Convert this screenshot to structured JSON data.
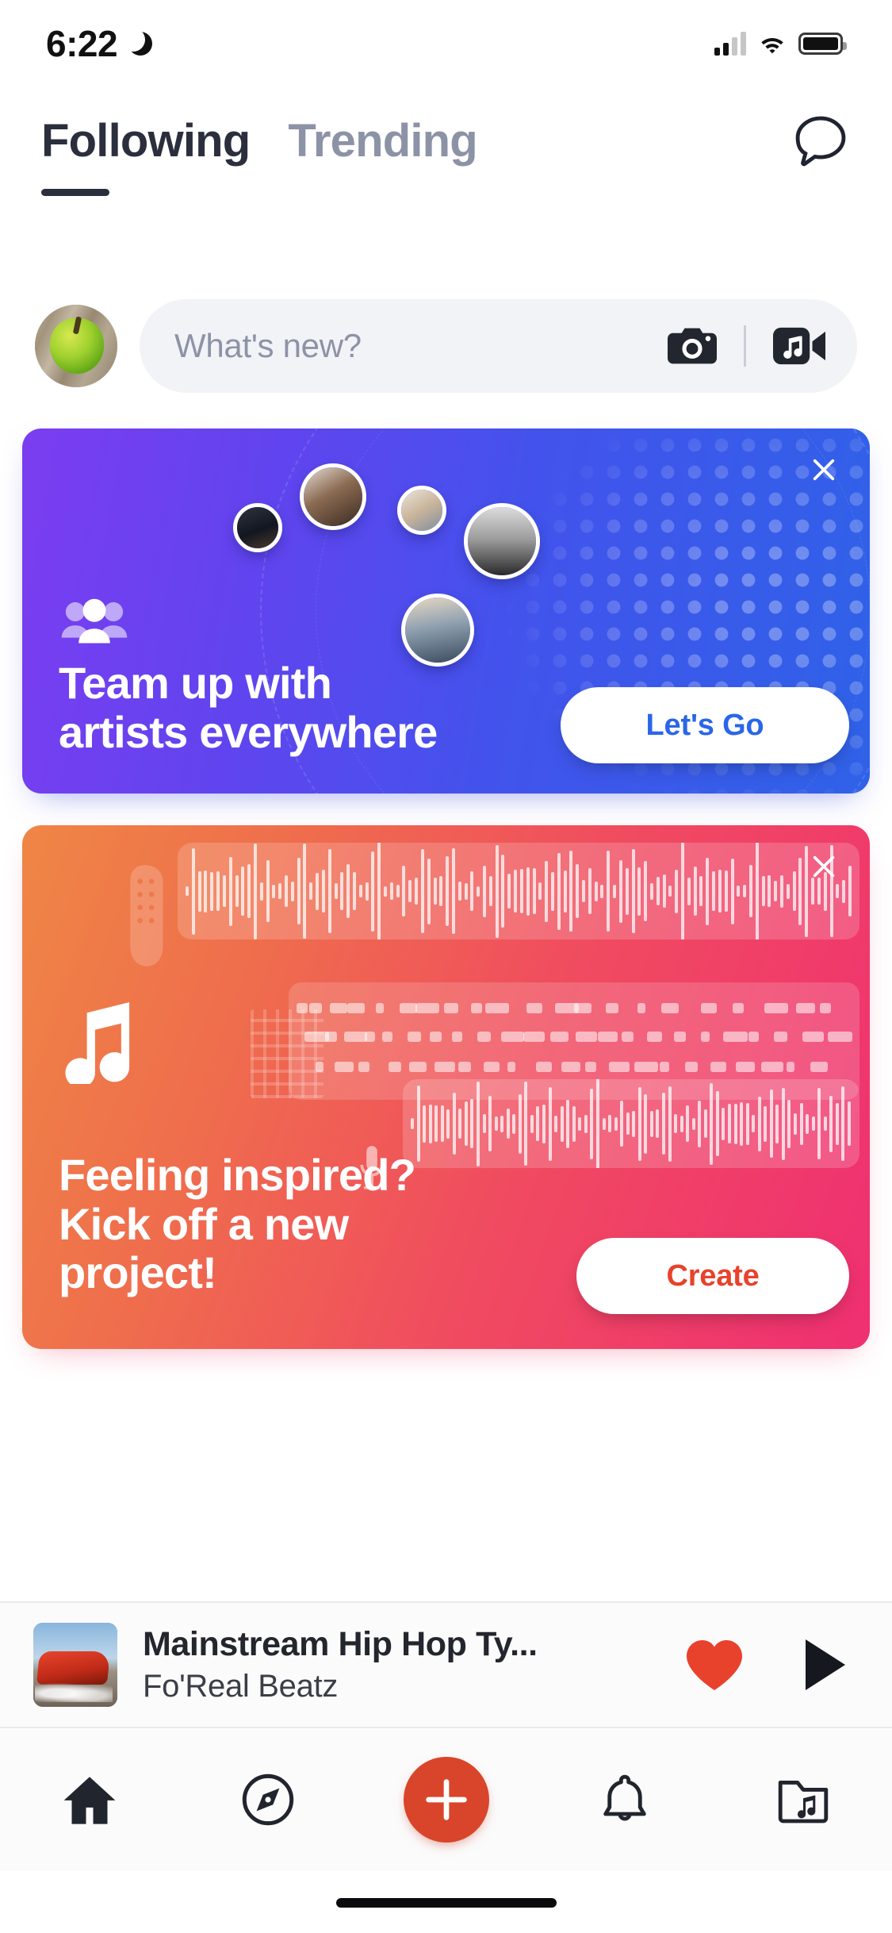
{
  "status_bar": {
    "time": "6:22",
    "dnd_icon": "crescent-moon-icon",
    "cellular_icon": "cellular-bars-icon",
    "wifi_icon": "wifi-icon",
    "battery_icon": "battery-full-icon"
  },
  "header": {
    "tabs": [
      {
        "label": "Following",
        "active": true
      },
      {
        "label": "Trending",
        "active": false
      }
    ],
    "chat_icon": "chat-bubble-icon"
  },
  "composer": {
    "avatar": "user-avatar-green-apple",
    "placeholder": "What's new?",
    "camera_icon": "camera-icon",
    "music_video_icon": "music-video-icon"
  },
  "cards": [
    {
      "id": "collab-card",
      "title_line1": "Team up with",
      "title_line2": "artists everywhere",
      "cta_label": "Let's Go",
      "cta_text_color": "#2a66e8",
      "close_icon": "close-x-icon",
      "badge_icon": "people-group-icon",
      "gradient_from": "#7b3df0",
      "gradient_to": "#2f62e8"
    },
    {
      "id": "create-project-card",
      "title_line1": "Feeling inspired?",
      "title_line2": "Kick off a new",
      "title_line3": "project!",
      "cta_label": "Create",
      "cta_text_color": "#e8422b",
      "close_icon": "close-x-icon",
      "badge_icon": "music-note-icon",
      "mic_icon": "microphone-icon",
      "guitar_icon": "guitar-headstock-icon",
      "gradient_from": "#ef8645",
      "gradient_to": "#ef2f72"
    }
  ],
  "now_playing": {
    "artwork": "red-muscle-car-artwork",
    "title": "Mainstream Hip Hop Ty...",
    "artist": "Fo'Real Beatz",
    "like_icon": "heart-filled-icon",
    "like_color": "#e8412c",
    "play_icon": "play-icon"
  },
  "bottom_nav": {
    "items": [
      {
        "name": "home",
        "icon": "home-icon",
        "active": true
      },
      {
        "name": "discover",
        "icon": "compass-icon",
        "active": false
      },
      {
        "name": "create",
        "icon": "plus-icon",
        "active": false
      },
      {
        "name": "notifications",
        "icon": "bell-icon",
        "active": false
      },
      {
        "name": "library",
        "icon": "music-folder-icon",
        "active": false
      }
    ],
    "fab_color": "#d9452a"
  }
}
